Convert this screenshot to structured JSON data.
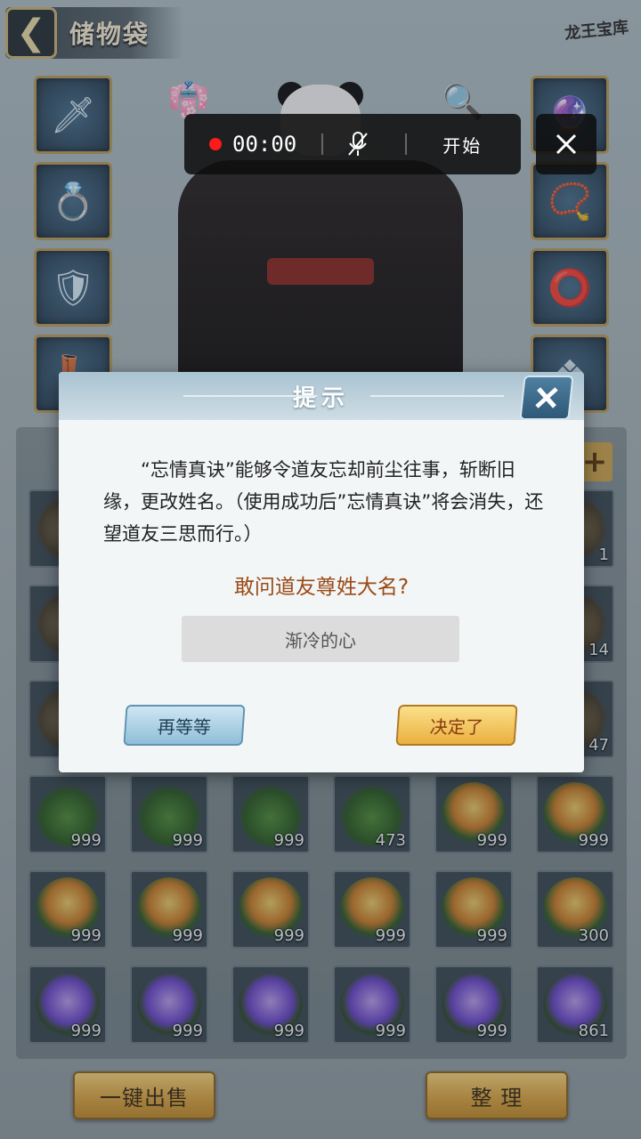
{
  "header": {
    "back_glyph": "❮",
    "title": "储物袋",
    "logo": "龙王宝库"
  },
  "equipment": {
    "left_slots": [
      "sword-icon",
      "ring-icon",
      "armor-icon",
      "boots-icon"
    ],
    "right_slots": [
      "orb-icon",
      "pendant-icon",
      "bracelet-icon",
      "jade-icon"
    ]
  },
  "recorder": {
    "time": "00:00",
    "start_label": "开始"
  },
  "dialog": {
    "title": "提示",
    "body": "“忘情真诀”能够令道友忘却前尘往事，斩断旧缘，更改姓名。（使用成功后”忘情真诀”将会消失，还望道友三思而行。）",
    "question": "敢问道友尊姓大名?",
    "input_value": "渐冷的心",
    "cancel_label": "再等等",
    "confirm_label": "决定了"
  },
  "bag": {
    "rows": [
      [
        {
          "art": "misc",
          "count": ""
        },
        {
          "art": "misc",
          "count": ""
        },
        {
          "art": "misc",
          "count": ""
        },
        {
          "art": "misc",
          "count": ""
        },
        {
          "art": "misc",
          "count": ""
        },
        {
          "art": "misc",
          "count": "1"
        }
      ],
      [
        {
          "art": "misc",
          "count": ""
        },
        {
          "art": "misc",
          "count": ""
        },
        {
          "art": "misc",
          "count": ""
        },
        {
          "art": "misc",
          "count": ""
        },
        {
          "art": "misc",
          "count": ""
        },
        {
          "art": "misc",
          "count": "14"
        }
      ],
      [
        {
          "art": "misc",
          "count": ""
        },
        {
          "art": "misc",
          "count": ""
        },
        {
          "art": "misc",
          "count": ""
        },
        {
          "art": "misc",
          "count": ""
        },
        {
          "art": "misc",
          "count": ""
        },
        {
          "art": "misc",
          "count": "47"
        }
      ],
      [
        {
          "art": "leaf",
          "count": "999"
        },
        {
          "art": "leaf",
          "count": "999"
        },
        {
          "art": "leaf",
          "count": "999"
        },
        {
          "art": "leaf",
          "count": "473"
        },
        {
          "art": "honey",
          "count": "999"
        },
        {
          "art": "honey",
          "count": "999"
        }
      ],
      [
        {
          "art": "honey",
          "count": "999"
        },
        {
          "art": "honey",
          "count": "999"
        },
        {
          "art": "honey",
          "count": "999"
        },
        {
          "art": "honey",
          "count": "999"
        },
        {
          "art": "honey",
          "count": "999"
        },
        {
          "art": "honey",
          "count": "300"
        }
      ],
      [
        {
          "art": "lotus",
          "count": "999"
        },
        {
          "art": "lotus",
          "count": "999"
        },
        {
          "art": "lotus",
          "count": "999"
        },
        {
          "art": "lotus",
          "count": "999"
        },
        {
          "art": "lotus",
          "count": "999"
        },
        {
          "art": "lotus",
          "count": "861"
        }
      ]
    ],
    "plus_label": "+"
  },
  "bottom": {
    "sell_all_label": "一键出售",
    "sort_label": "整 理"
  }
}
